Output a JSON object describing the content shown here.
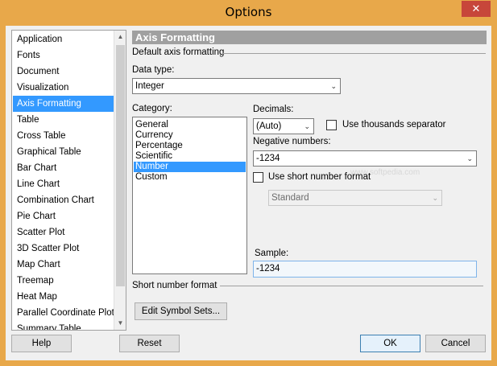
{
  "window": {
    "title": "Options",
    "close_glyph": "✕"
  },
  "nav": {
    "items": [
      "Application",
      "Fonts",
      "Document",
      "Visualization",
      "Axis Formatting",
      "Table",
      "Cross Table",
      "Graphical Table",
      "Bar Chart",
      "Line Chart",
      "Combination Chart",
      "Pie Chart",
      "Scatter Plot",
      "3D Scatter Plot",
      "Map Chart",
      "Treemap",
      "Heat Map",
      "Parallel Coordinate Plot",
      "Summary Table"
    ],
    "selected": "Axis Formatting",
    "scroll_up_glyph": "▲",
    "scroll_down_glyph": "▼"
  },
  "panel": {
    "header": "Axis Formatting",
    "default_group": "Default axis formatting",
    "data_type_label": "Data type:",
    "data_type_value": "Integer",
    "category_label": "Category:",
    "categories": [
      "General",
      "Currency",
      "Percentage",
      "Scientific",
      "Number",
      "Custom"
    ],
    "selected_category": "Number",
    "decimals_label": "Decimals:",
    "decimals_value": "(Auto)",
    "thousands_label": "Use thousands separator",
    "thousands_checked": false,
    "negative_label": "Negative numbers:",
    "negative_value": "-1234",
    "short_format_check_label": "Use short number format",
    "short_format_checked": false,
    "short_format_value": "Standard",
    "sample_label": "Sample:",
    "sample_value": "-1234",
    "short_group": "Short number format",
    "edit_symbol_sets": "Edit Symbol Sets...",
    "chevron_glyph": "⌄",
    "watermark": "www.softpedia.com"
  },
  "footer": {
    "help": "Help",
    "reset": "Reset",
    "ok": "OK",
    "cancel": "Cancel"
  },
  "colors": {
    "title_bar": "#e8a84a",
    "selection": "#3399ff",
    "close_button": "#c7463a",
    "section_header": "#a0a0a0"
  }
}
